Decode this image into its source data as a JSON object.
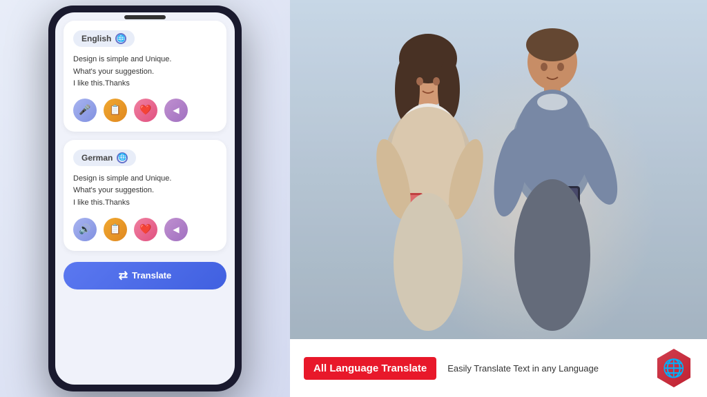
{
  "app": {
    "name": "All Language Translate"
  },
  "phone": {
    "source_card": {
      "language": "English",
      "text": "Design is simple and Unique.\nWhat's your suggestion.\nI like this.Thanks",
      "buttons": [
        "mic",
        "copy",
        "heart",
        "share"
      ]
    },
    "target_card": {
      "language": "German",
      "text": "Design is simple and Unique.\nWhat's your suggestion.\nI like this.Thanks",
      "buttons": [
        "speaker",
        "copy",
        "heart",
        "share"
      ]
    },
    "translate_button": "Translate"
  },
  "banner": {
    "title": "All Language Translate",
    "subtitle": "Easily Translate Text in any  Language"
  },
  "icons": {
    "globe": "🌐",
    "mic": "🎤",
    "copy": "📋",
    "heart": "❤️",
    "share": "◀",
    "speaker": "🔊",
    "translate_icon": "⇄"
  }
}
